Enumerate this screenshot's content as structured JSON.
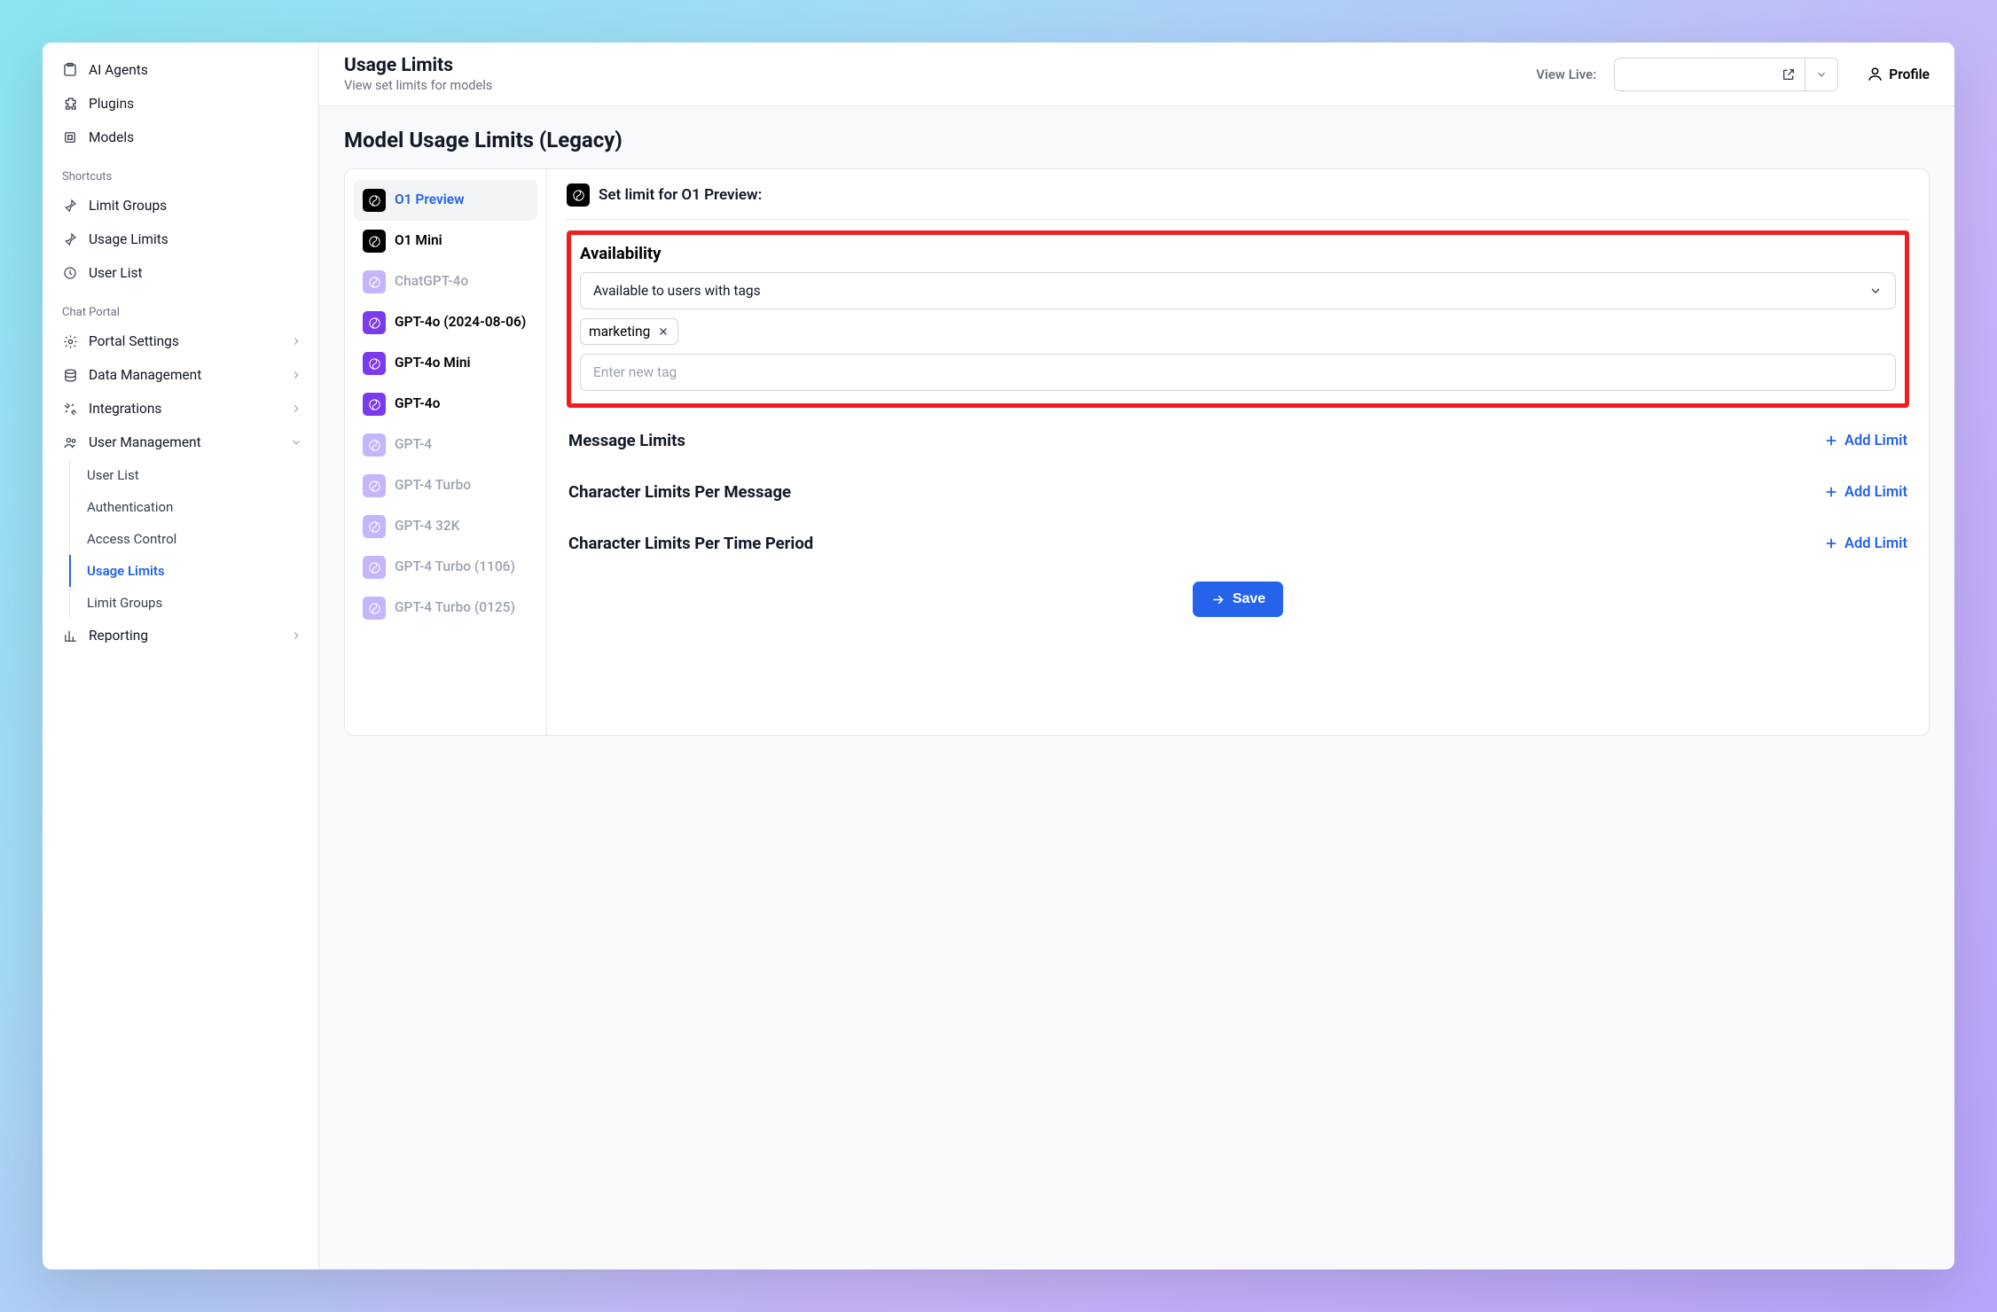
{
  "sidebar": {
    "top": [
      {
        "label": "AI Agents"
      },
      {
        "label": "Plugins"
      },
      {
        "label": "Models"
      }
    ],
    "section_shortcuts": "Shortcuts",
    "shortcuts": [
      {
        "label": "Limit Groups"
      },
      {
        "label": "Usage Limits"
      },
      {
        "label": "User List"
      }
    ],
    "section_chatportal": "Chat Portal",
    "chatportal": [
      {
        "label": "Portal Settings"
      },
      {
        "label": "Data Management"
      },
      {
        "label": "Integrations"
      },
      {
        "label": "User Management"
      }
    ],
    "user_mgmt_sub": [
      {
        "label": "User List"
      },
      {
        "label": "Authentication"
      },
      {
        "label": "Access Control"
      },
      {
        "label": "Usage Limits"
      },
      {
        "label": "Limit Groups"
      }
    ],
    "reporting": "Reporting"
  },
  "topbar": {
    "title": "Usage Limits",
    "subtitle": "View set limits for models",
    "viewlive_label": "View Live:",
    "profile": "Profile"
  },
  "content": {
    "heading": "Model Usage Limits (Legacy)",
    "detail_header": "Set limit for O1 Preview:",
    "availability_title": "Availability",
    "availability_value": "Available to users with tags",
    "tag": "marketing",
    "tag_placeholder": "Enter new tag",
    "limits": [
      "Message Limits",
      "Character Limits Per Message",
      "Character Limits Per Time Period"
    ],
    "add_limit": "Add Limit",
    "save": "Save"
  },
  "models": [
    {
      "name": "O1 Preview",
      "style": "dark",
      "active": true
    },
    {
      "name": "O1 Mini",
      "style": "dark"
    },
    {
      "name": "ChatGPT-4o",
      "style": "dim"
    },
    {
      "name": "GPT-4o (2024-08-06)",
      "style": "purple"
    },
    {
      "name": "GPT-4o Mini",
      "style": "purple"
    },
    {
      "name": "GPT-4o",
      "style": "purple"
    },
    {
      "name": "GPT-4",
      "style": "dim"
    },
    {
      "name": "GPT-4 Turbo",
      "style": "dim"
    },
    {
      "name": "GPT-4 32K",
      "style": "dim"
    },
    {
      "name": "GPT-4 Turbo (1106)",
      "style": "dim"
    },
    {
      "name": "GPT-4 Turbo (0125)",
      "style": "dim"
    }
  ]
}
